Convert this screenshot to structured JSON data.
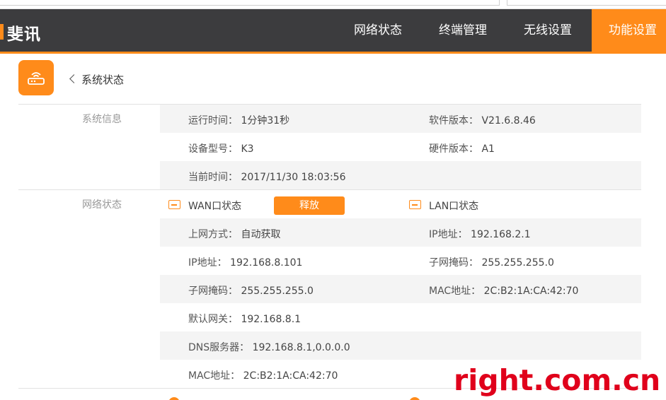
{
  "header": {
    "brand": "斐讯",
    "nav": [
      {
        "label": "网络状态",
        "active": false
      },
      {
        "label": "终端管理",
        "active": false
      },
      {
        "label": "无线设置",
        "active": false
      },
      {
        "label": "功能设置",
        "active": true
      }
    ]
  },
  "page": {
    "back_label": "系统状态",
    "icon": "router-icon"
  },
  "system_info": {
    "label": "系统信息",
    "uptime_k": "运行时间：",
    "uptime_v": "1分钟31秒",
    "sw_k": "软件版本：",
    "sw_v": "V21.6.8.46",
    "model_k": "设备型号：",
    "model_v": "K3",
    "hw_k": "硬件版本：",
    "hw_v": "A1",
    "time_k": "当前时间：",
    "time_v": "2017/11/30 18:03:56"
  },
  "network_status": {
    "label": "网络状态",
    "wan_title": "WAN口状态",
    "release_btn": "释放",
    "lan_title": "LAN口状态",
    "wan": {
      "mode_k": "上网方式：",
      "mode_v": "自动获取",
      "ip_k": "IP地址：",
      "ip_v": "192.168.8.101",
      "mask_k": "子网掩码：",
      "mask_v": "255.255.255.0",
      "gw_k": "默认网关：",
      "gw_v": "192.168.8.1",
      "dns_k": "DNS服务器：",
      "dns_v": "192.168.8.1,0.0.0.0",
      "mac_k": "MAC地址：",
      "mac_v": "2C:B2:1A:CA:42:70"
    },
    "lan": {
      "ip_k": "IP地址：",
      "ip_v": "192.168.2.1",
      "mask_k": "子网掩码：",
      "mask_v": "255.255.255.0",
      "mac_k": "MAC地址：",
      "mac_v": "2C:B2:1A:CA:42:70"
    }
  },
  "watermark": "right.com.cn",
  "colors": {
    "accent": "#ff8b1a",
    "nav_bg": "#3c3c3e",
    "watermark": "#e0001b"
  }
}
